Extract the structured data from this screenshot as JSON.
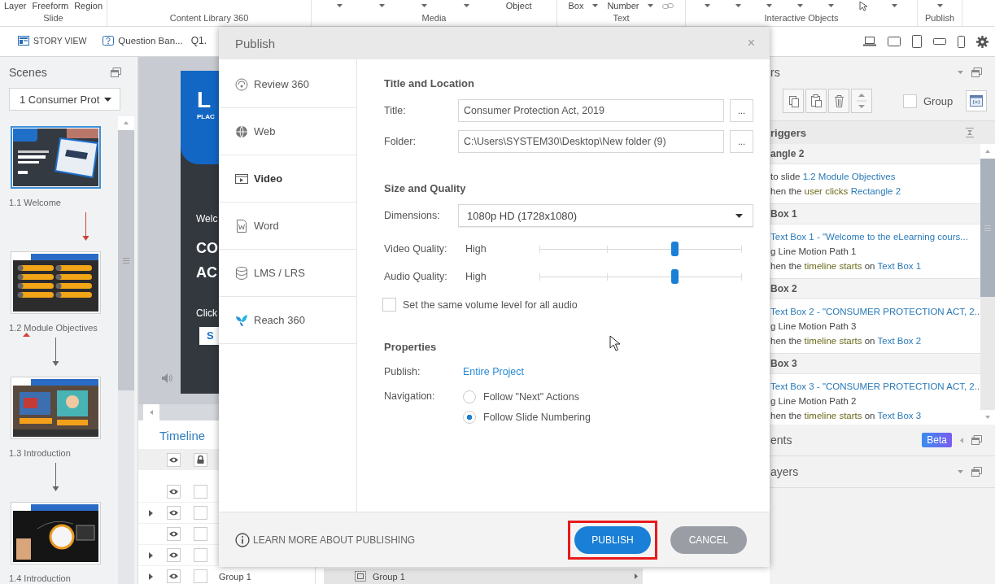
{
  "ribbon": {
    "groups": [
      {
        "label": "Slide",
        "items": [
          {
            "kind": "text",
            "text": "Layer"
          },
          {
            "kind": "text",
            "text": "Freeform"
          },
          {
            "kind": "text",
            "text": "Region"
          }
        ]
      },
      {
        "label": "Content Library 360"
      },
      {
        "label": "Media",
        "items": [
          {
            "kind": "caret"
          },
          {
            "kind": "caret"
          },
          {
            "kind": "caret"
          },
          {
            "kind": "caret"
          },
          {
            "kind": "text",
            "text": "Object"
          }
        ]
      },
      {
        "label": "Text",
        "items": [
          {
            "kind": "text",
            "text": "Box"
          },
          {
            "kind": "caret"
          },
          {
            "kind": "text",
            "text": "Number"
          },
          {
            "kind": "caret"
          },
          {
            "kind": "chain"
          }
        ]
      },
      {
        "label": "Interactive Objects",
        "items": [
          {
            "kind": "caret"
          },
          {
            "kind": "caret"
          },
          {
            "kind": "caret"
          },
          {
            "kind": "caret"
          },
          {
            "kind": "caret"
          },
          {
            "kind": "pointer"
          },
          {
            "kind": "caret"
          }
        ]
      },
      {
        "label": "Publish",
        "items": [
          {
            "kind": "caret"
          }
        ]
      }
    ]
  },
  "tabs": [
    {
      "label": "STORY VIEW",
      "kind": "story",
      "selected": false
    },
    {
      "label": "Question Ban...",
      "kind": "question",
      "selected": false
    },
    {
      "label": "Q1.",
      "kind": "slide",
      "selected": false
    }
  ],
  "scenes": {
    "title": "Scenes",
    "scene_select": "1 Consumer Prot",
    "slides": [
      {
        "label": "1.1 Welcome",
        "kind": "welcome",
        "selected": true,
        "flagged": false,
        "arrow": {
          "kind": "trigger"
        }
      },
      {
        "label": "1.2 Module Objectives",
        "kind": "objectives",
        "selected": false,
        "flagged": true,
        "arrow": {
          "kind": "sequence"
        }
      },
      {
        "label": "1.3 Introduction",
        "kind": "photo",
        "selected": false,
        "flagged": false,
        "arrow": {
          "kind": "sequence"
        }
      },
      {
        "label": "1.4 Introduction",
        "kind": "dark",
        "selected": false,
        "flagged": false
      }
    ]
  },
  "slide_preview": {
    "logo": "L",
    "logo_caption": "PLAC",
    "welcome": "Welc",
    "title_lines": [
      "CO",
      "AC"
    ],
    "prompt": "Click",
    "button": "S"
  },
  "timeline": {
    "title": "Timeline",
    "rows": [
      {
        "expandable": false
      },
      {
        "expandable": true
      },
      {
        "expandable": false
      },
      {
        "expandable": true
      },
      {
        "expandable": true,
        "name": "Group 1",
        "bar": "Group 1"
      }
    ]
  },
  "right_panel": {
    "header": "rs",
    "group_checkbox": {
      "label": "Group",
      "checked": false
    },
    "triggers": {
      "title": "riggers",
      "groups": [
        {
          "title": "angle 2",
          "lines": [
            [
              {
                "kind": "plain",
                "text": "to slide "
              },
              {
                "kind": "link",
                "text": "1.2 Module Objectives"
              }
            ],
            [
              {
                "kind": "plain",
                "text": "hen the "
              },
              {
                "kind": "event",
                "text": "user clicks"
              },
              {
                "kind": "link",
                "text": "Rectangle 2"
              }
            ]
          ]
        },
        {
          "title": "Box 1",
          "lines": [
            [
              {
                "kind": "link",
                "text": "Text Box 1 - \"Welcome to the eLearning cours..."
              }
            ],
            [
              {
                "kind": "plain",
                "text": "g Line Motion Path 1"
              }
            ],
            [
              {
                "kind": "plain",
                "text": "hen the "
              },
              {
                "kind": "event",
                "text": "timeline starts"
              },
              {
                "kind": "plain",
                "text": " on "
              },
              {
                "kind": "link",
                "text": "Text Box 1"
              }
            ]
          ]
        },
        {
          "title": "Box 2",
          "lines": [
            [
              {
                "kind": "link",
                "text": "Text Box 2 - \"CONSUMER PROTECTION ACT, 2..."
              }
            ],
            [
              {
                "kind": "plain",
                "text": "g Line Motion Path 3"
              }
            ],
            [
              {
                "kind": "plain",
                "text": "hen the "
              },
              {
                "kind": "event",
                "text": "timeline starts"
              },
              {
                "kind": "plain",
                "text": " on "
              },
              {
                "kind": "link",
                "text": "Text Box 2"
              }
            ]
          ]
        },
        {
          "title": "Box 3",
          "lines": [
            [
              {
                "kind": "link",
                "text": "Text Box 3 - \"CONSUMER PROTECTION ACT, 2..."
              }
            ],
            [
              {
                "kind": "plain",
                "text": "g Line Motion Path 2"
              }
            ],
            [
              {
                "kind": "plain",
                "text": "hen the "
              },
              {
                "kind": "event",
                "text": "timeline starts"
              },
              {
                "kind": "plain",
                "text": " on "
              },
              {
                "kind": "link",
                "text": "Text Box 3"
              }
            ]
          ]
        }
      ]
    },
    "sections": [
      {
        "title": "ents",
        "badge": "Beta"
      },
      {
        "title": "ayers"
      }
    ]
  },
  "dialog": {
    "title": "Publish",
    "close": "×",
    "nav": [
      {
        "label": "Review 360",
        "kind": "review",
        "selected": false
      },
      {
        "label": "Web",
        "kind": "web",
        "selected": false
      },
      {
        "label": "Video",
        "kind": "video",
        "selected": true
      },
      {
        "label": "Word",
        "kind": "word",
        "selected": false
      },
      {
        "label": "LMS / LRS",
        "kind": "lms",
        "selected": false
      },
      {
        "label": "Reach 360",
        "kind": "reach",
        "selected": false
      }
    ],
    "title_location": {
      "heading": "Title and Location",
      "title": {
        "label": "Title:",
        "value": "Consumer Protection Act, 2019",
        "button": "..."
      },
      "folder": {
        "label": "Folder:",
        "value": "C:\\Users\\SYSTEM30\\Desktop\\New folder (9)",
        "button": "..."
      }
    },
    "size_quality": {
      "heading": "Size and Quality",
      "dimensions": {
        "label": "Dimensions:",
        "value": "1080p HD (1728x1080)"
      },
      "video_quality": {
        "label": "Video Quality:",
        "reading": "High",
        "level": 0.67
      },
      "audio_quality": {
        "label": "Audio Quality:",
        "reading": "High",
        "level": 0.67
      },
      "same_volume": {
        "label": "Set the same volume level for all audio",
        "checked": false
      }
    },
    "properties": {
      "heading": "Properties",
      "publish": {
        "label": "Publish:",
        "value": "Entire Project"
      },
      "navigation": {
        "label": "Navigation:",
        "options": [
          {
            "label": "Follow \"Next\" Actions",
            "selected": false
          },
          {
            "label": "Follow Slide Numbering",
            "selected": true
          }
        ]
      }
    },
    "footer": {
      "learn_more": "LEARN MORE ABOUT PUBLISHING",
      "buttons": [
        {
          "label": "PUBLISH",
          "kind": "primary",
          "highlighted": true
        },
        {
          "label": "CANCEL",
          "kind": "secondary",
          "highlighted": false
        }
      ]
    }
  }
}
